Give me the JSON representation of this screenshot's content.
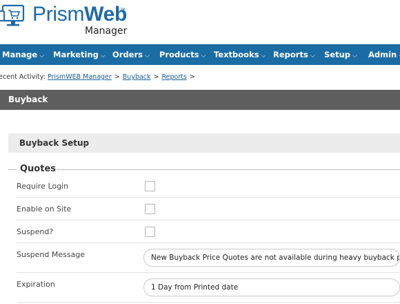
{
  "app": {
    "logo_prism": "Prism",
    "logo_web": "Web",
    "logo_tm": "™",
    "logo_subtitle": "Manager"
  },
  "colors": {
    "brand_blue": "#1a6ca5",
    "title_bar": "#5e5e5e",
    "section_bar": "#ececec",
    "link": "#1a5f99"
  },
  "nav": {
    "items": [
      {
        "label": "Manage",
        "icon": "chevron-down-icon"
      },
      {
        "label": "Marketing",
        "icon": "chevron-down-icon"
      },
      {
        "label": "Orders",
        "icon": "chevron-down-icon"
      },
      {
        "label": "Products",
        "icon": "chevron-down-icon"
      },
      {
        "label": "Textbooks",
        "icon": "chevron-down-icon"
      },
      {
        "label": "Reports",
        "icon": "chevron-down-icon"
      },
      {
        "label": "Setup",
        "icon": "chevron-down-icon"
      },
      {
        "label": "Admin",
        "icon": "chevron-down-icon"
      }
    ],
    "chevron": "⌵"
  },
  "breadcrumb": {
    "prefix": "Recent Activity:",
    "links": [
      "PrismWEB Manager",
      "Buyback",
      "Reports"
    ],
    "separator": ">"
  },
  "page": {
    "title": "Buyback",
    "section_title": "Buyback Setup",
    "fieldset_legend": "Quotes"
  },
  "form": {
    "require_login": {
      "label": "Require Login",
      "checked": false
    },
    "enable_on_site": {
      "label": "Enable on Site",
      "checked": false
    },
    "suspend": {
      "label": "Suspend?",
      "checked": false
    },
    "suspend_message": {
      "label": "Suspend Message",
      "value": "New Buyback Price Quotes are not available during heavy buyback periods."
    },
    "expiration": {
      "label": "Expiration",
      "value": "1 Day from Printed date"
    }
  }
}
